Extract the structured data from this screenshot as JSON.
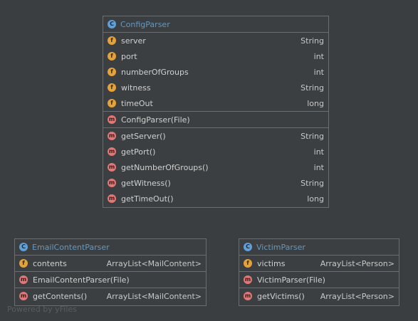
{
  "classes": {
    "config": {
      "badge": "C",
      "name": "ConfigParser",
      "fields": [
        {
          "badge": "f",
          "name": "server",
          "type": "String"
        },
        {
          "badge": "f",
          "name": "port",
          "type": "int"
        },
        {
          "badge": "f",
          "name": "numberOfGroups",
          "type": "int"
        },
        {
          "badge": "f",
          "name": "witness",
          "type": "String"
        },
        {
          "badge": "f",
          "name": "timeOut",
          "type": "long"
        }
      ],
      "constructors": [
        {
          "badge": "m",
          "name": "ConfigParser(File)",
          "type": ""
        }
      ],
      "methods": [
        {
          "badge": "m",
          "name": "getServer()",
          "type": "String"
        },
        {
          "badge": "m",
          "name": "getPort()",
          "type": "int"
        },
        {
          "badge": "m",
          "name": "getNumberOfGroups()",
          "type": "int"
        },
        {
          "badge": "m",
          "name": "getWitness()",
          "type": "String"
        },
        {
          "badge": "m",
          "name": "getTimeOut()",
          "type": "long"
        }
      ]
    },
    "email": {
      "badge": "C",
      "name": "EmailContentParser",
      "fields": [
        {
          "badge": "f",
          "name": "contents",
          "type": "ArrayList<MailContent>"
        }
      ],
      "constructors": [
        {
          "badge": "m",
          "name": "EmailContentParser(File)",
          "type": ""
        }
      ],
      "methods": [
        {
          "badge": "m",
          "name": "getContents()",
          "type": "ArrayList<MailContent>"
        }
      ]
    },
    "victim": {
      "badge": "C",
      "name": "VictimParser",
      "fields": [
        {
          "badge": "f",
          "name": "victims",
          "type": "ArrayList<Person>"
        }
      ],
      "constructors": [
        {
          "badge": "m",
          "name": "VictimParser(File)",
          "type": ""
        }
      ],
      "methods": [
        {
          "badge": "m",
          "name": "getVictims()",
          "type": "ArrayList<Person>"
        }
      ]
    }
  },
  "watermark": "Powered by yFiles",
  "colors": {
    "background": "#3b3e40",
    "class_name": "#6897bb",
    "badge_class": "#5fa0d8",
    "badge_field": "#e6a23a",
    "badge_method": "#e07878",
    "border": "#6b6e70"
  }
}
